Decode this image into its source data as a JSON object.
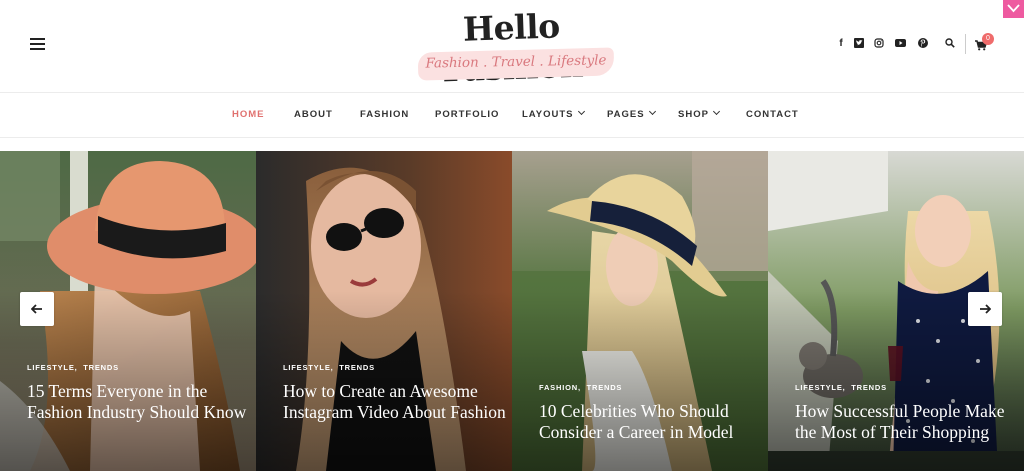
{
  "brand": {
    "title": "Hello Fashion",
    "tagline": "Fashion . Travel . Lifestyle",
    "accent": "#e0716f"
  },
  "header": {
    "social": [
      "facebook-icon",
      "twitter-icon",
      "instagram-icon",
      "youtube-icon",
      "pinterest-icon"
    ],
    "cart_count": "0"
  },
  "nav": {
    "items": [
      {
        "label": "HOME",
        "active": true
      },
      {
        "label": "ABOUT"
      },
      {
        "label": "FASHION"
      },
      {
        "label": "PORTFOLIO"
      },
      {
        "label": "LAYOUTS",
        "dropdown": true
      },
      {
        "label": "PAGES",
        "dropdown": true
      },
      {
        "label": "SHOP",
        "dropdown": true
      },
      {
        "label": "CONTACT"
      }
    ]
  },
  "slides": [
    {
      "cat1": "LIFESTYLE",
      "cat2": "TRENDS",
      "title": "15 Terms Everyone in the Fashion Industry Should Know"
    },
    {
      "cat1": "LIFESTYLE",
      "cat2": "TRENDS",
      "title": "How to Create an Awesome Instagram Video About Fashion"
    },
    {
      "cat1": "FASHION",
      "cat2": "TRENDS",
      "title": "10 Celebrities Who Should Consider a Career in Model"
    },
    {
      "cat1": "LIFESTYLE",
      "cat2": "TRENDS",
      "title": "How Successful People Make the Most of Their Shopping"
    }
  ]
}
